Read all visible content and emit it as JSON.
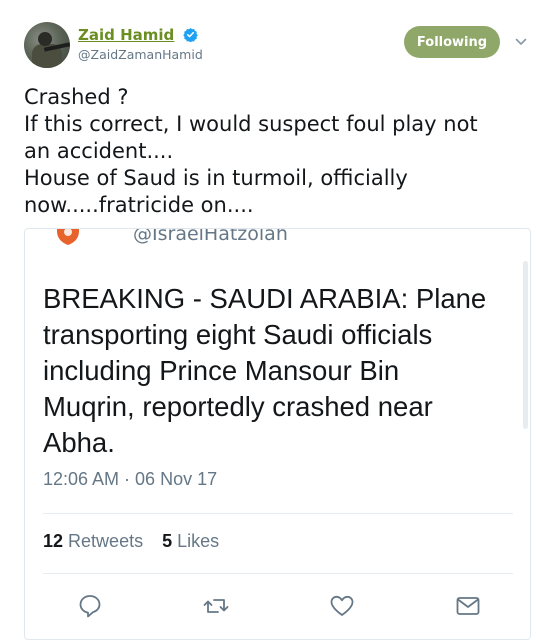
{
  "author": {
    "display_name": "Zaid Hamid",
    "handle": "@ZaidZamanHamid",
    "verified": true
  },
  "follow_button": {
    "label": "Following"
  },
  "tweet": {
    "lines": [
      "Crashed ?",
      "If this correct, I would suspect foul play not",
      "an accident....",
      "House of Saud is in turmoil, officially",
      "now.....fratricide on...."
    ]
  },
  "embedded": {
    "handle": "@IsraelHatzolah",
    "headline_lines": [
      "BREAKING - SAUDI ARABIA: Plane",
      "transporting eight Saudi officials",
      "including Prince Mansour Bin",
      "Muqrin, reportedly crashed near",
      "Abha."
    ],
    "timestamp": "12:06 AM · 06 Nov 17",
    "retweets_count": "12",
    "retweets_label": "Retweets",
    "likes_count": "5",
    "likes_label": "Likes"
  },
  "colors": {
    "name": "#6b8e23",
    "follow_bg": "#8fa86a",
    "verified": "#1da1f2",
    "secondary_text": "#657786"
  },
  "icons": {
    "verified": "verified-badge-icon",
    "caret": "chevron-down-icon",
    "reply": "reply-icon",
    "retweet": "retweet-icon",
    "like": "heart-icon",
    "message": "envelope-icon"
  }
}
